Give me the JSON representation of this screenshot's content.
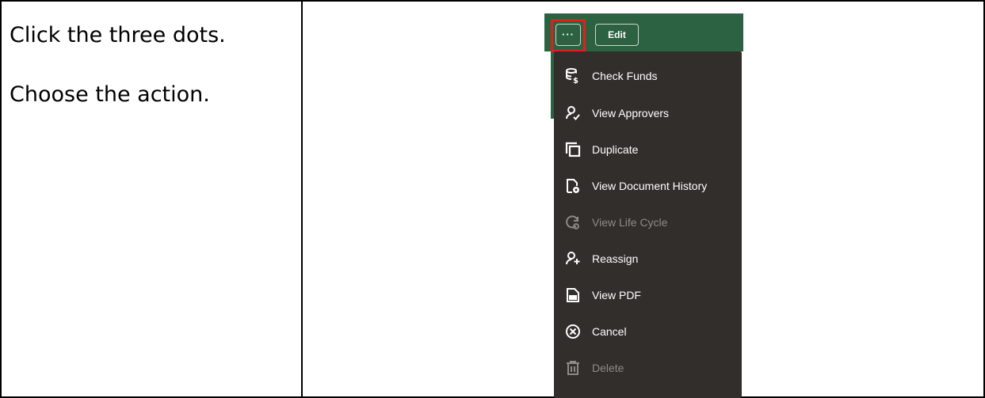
{
  "instructions": {
    "step1": "Click the three dots.",
    "step2": "Choose the action."
  },
  "toolbar": {
    "more_label": "···",
    "edit_label": "Edit"
  },
  "menu": {
    "items": [
      {
        "label": "Check Funds",
        "icon": "funds-icon",
        "enabled": true
      },
      {
        "label": "View Approvers",
        "icon": "approvers-icon",
        "enabled": true
      },
      {
        "label": "Duplicate",
        "icon": "duplicate-icon",
        "enabled": true
      },
      {
        "label": "View Document History",
        "icon": "document-history-icon",
        "enabled": true
      },
      {
        "label": "View Life Cycle",
        "icon": "life-cycle-icon",
        "enabled": false
      },
      {
        "label": "Reassign",
        "icon": "reassign-icon",
        "enabled": true
      },
      {
        "label": "View PDF",
        "icon": "pdf-icon",
        "enabled": true
      },
      {
        "label": "Cancel",
        "icon": "cancel-icon",
        "enabled": true
      },
      {
        "label": "Delete",
        "icon": "trash-icon",
        "enabled": false
      }
    ]
  },
  "colors": {
    "header_green": "#2c6141",
    "menu_background": "#322e2b",
    "highlight_red": "#e0201b",
    "disabled_text": "#8f8a86"
  }
}
